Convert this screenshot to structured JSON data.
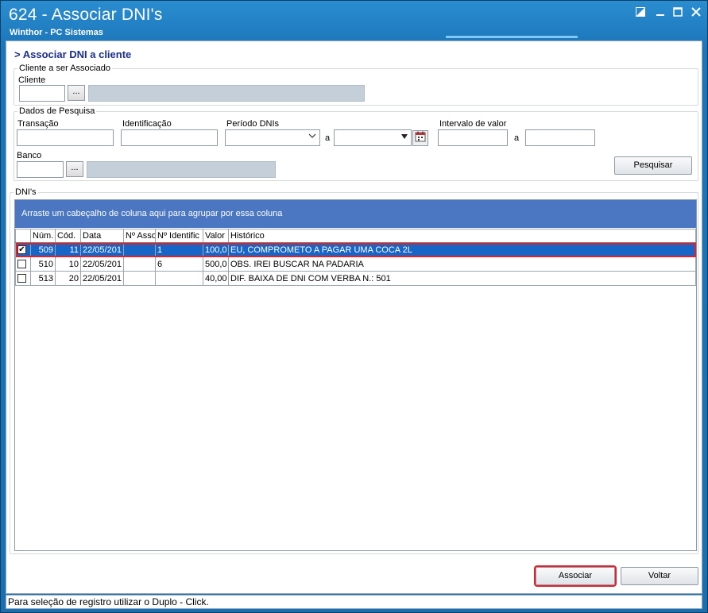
{
  "window": {
    "title": "624 - Associar DNI's",
    "subtitle": "Winthor - PC Sistemas",
    "controls": [
      "restore-down",
      "minimize",
      "maximize",
      "close"
    ]
  },
  "header": {
    "section_title": "> Associar DNI a cliente"
  },
  "cliente_group": {
    "legend": "Cliente a ser Associado",
    "cliente_label": "Cliente",
    "cliente_value": "",
    "lookup_button": "...",
    "cliente_name": ""
  },
  "pesquisa_group": {
    "legend": "Dados de Pesquisa",
    "transacao_label": "Transação",
    "transacao_value": "",
    "identificacao_label": "Identificação",
    "identificacao_value": "",
    "periodo_label": "Período DNIs",
    "periodo_from": "",
    "periodo_sep": "a",
    "periodo_to": "",
    "intervalo_label": "Intervalo de valor",
    "intervalo_from": "",
    "intervalo_sep": "a",
    "intervalo_to": "",
    "banco_label": "Banco",
    "banco_value": "",
    "banco_lookup": "...",
    "banco_name": "",
    "pesquisar_button": "Pesquisar"
  },
  "dnis_group": {
    "legend": "DNI's",
    "group_hint": "Arraste um cabeçalho de coluna aqui para agrupar por essa coluna",
    "columns": [
      "",
      "Núm.",
      "Cód.",
      "Data",
      "Nº Associ",
      "Nº Identific",
      "Valor",
      "Histórico"
    ],
    "rows": [
      {
        "checked": true,
        "num": "509",
        "cod": "11",
        "data": "22/05/201",
        "assoc": "",
        "ident": "1",
        "valor": "100,0",
        "historico": "EU, COMPROMETO A PAGAR UMA COCA 2L",
        "selected": true
      },
      {
        "checked": false,
        "num": "510",
        "cod": "10",
        "data": "22/05/201",
        "assoc": "",
        "ident": "6",
        "valor": "500,0",
        "historico": "OBS. IREI BUSCAR NA PADARIA",
        "selected": false
      },
      {
        "checked": false,
        "num": "513",
        "cod": "20",
        "data": "22/05/201",
        "assoc": "",
        "ident": "",
        "valor": "40,00",
        "historico": "DIF. BAIXA DE DNI COM VERBA N.: 501",
        "selected": false
      }
    ]
  },
  "footer": {
    "associar_button": "Associar",
    "voltar_button": "Voltar"
  },
  "statusbar": {
    "text": "Para seleção de registro utilizar o Duplo - Click."
  },
  "colors": {
    "title_bg": "#1b75b8",
    "selected_row": "#1765c7",
    "highlight": "#e0202a",
    "group_hint_bg": "#4a76c2",
    "section_title": "#1b2f8c"
  }
}
